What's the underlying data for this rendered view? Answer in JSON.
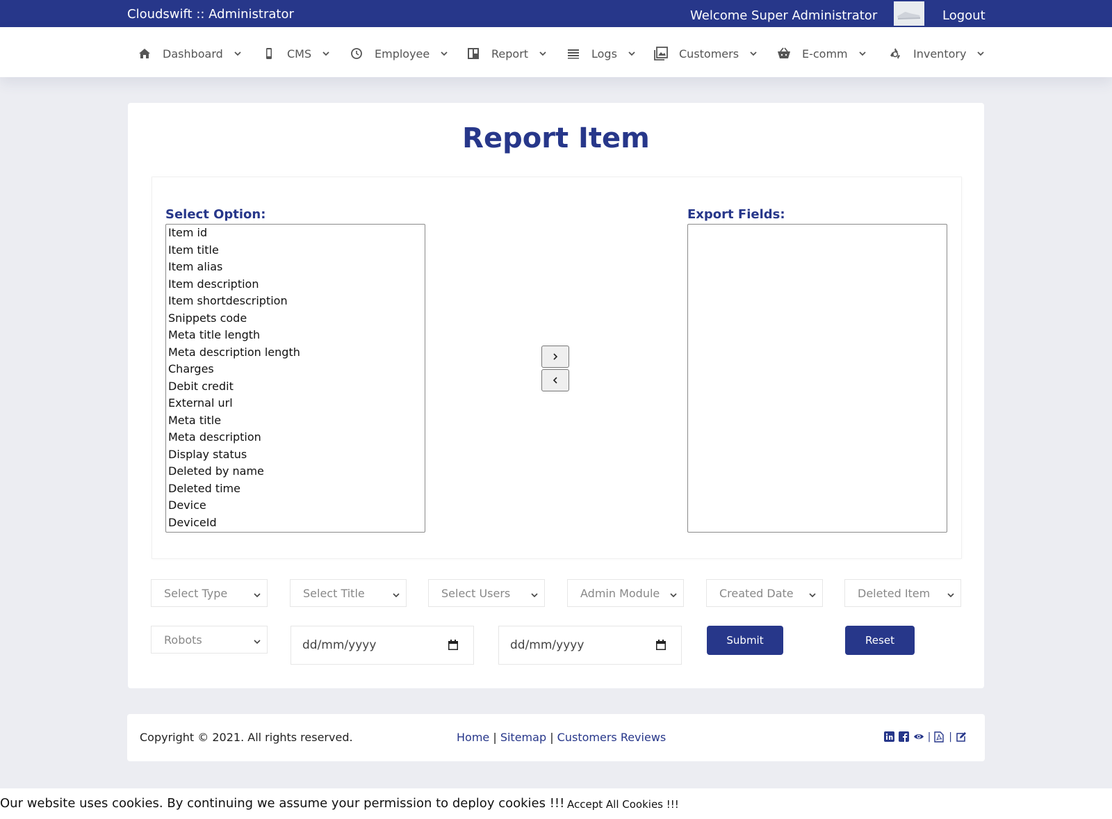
{
  "header": {
    "brand": "Cloudswift :: Administrator",
    "welcome": "Welcome Super Administrator",
    "logout": "Logout"
  },
  "nav": {
    "items": [
      {
        "label": "Dashboard",
        "icon": "home-icon"
      },
      {
        "label": "CMS",
        "icon": "mobile-icon"
      },
      {
        "label": "Employee",
        "icon": "clock-icon"
      },
      {
        "label": "Report",
        "icon": "columns-icon"
      },
      {
        "label": "Logs",
        "icon": "list-icon"
      },
      {
        "label": "Customers",
        "icon": "image-icon"
      },
      {
        "label": "E-comm",
        "icon": "basket-icon"
      },
      {
        "label": "Inventory",
        "icon": "recycle-icon"
      }
    ]
  },
  "main": {
    "title": "Report Item",
    "select_option_label": "Select Option:",
    "export_fields_label": "Export Fields:",
    "options": [
      "Item id",
      "Item title",
      "Item alias",
      "Item description",
      "Item shortdescription",
      "Snippets code",
      "Meta title length",
      "Meta description length",
      "Charges",
      "Debit credit",
      "External url",
      "Meta title",
      "Meta description",
      "Display status",
      "Deleted by name",
      "Deleted time",
      "Device",
      "DeviceId"
    ],
    "export_fields": [],
    "move_right": ">",
    "move_left": "<",
    "filters": {
      "type": "Select Type",
      "title": "Select Title",
      "users": "Select Users",
      "module": "Admin Module",
      "created": "Created Date",
      "deleted": "Deleted Item",
      "robots": "Robots"
    },
    "date_placeholder_from": "dd/mm/yyyy",
    "date_placeholder_to": "dd/mm/yyyy",
    "submit": "Submit",
    "reset": "Reset"
  },
  "footer": {
    "copyright": "Copyright © 2021. All rights reserved.",
    "links": [
      "Home",
      "Sitemap",
      "Customers Reviews"
    ],
    "separator": "|",
    "icons": [
      "linkedin-icon",
      "facebook-icon",
      "eye-icon",
      "pdf-icon",
      "edit-icon"
    ]
  },
  "cookie": {
    "text": "Our website uses cookies. By continuing we assume your permission to deploy cookies !!!",
    "accept": "Accept All Cookies !!!"
  },
  "colors": {
    "primary": "#27378a",
    "background": "#ecedf2"
  }
}
